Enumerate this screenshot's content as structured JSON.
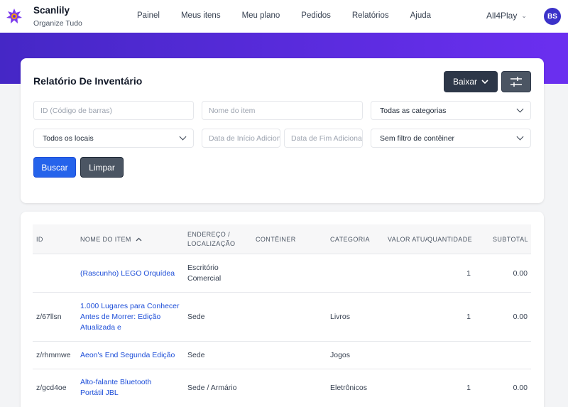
{
  "nav": {
    "brand": "Scanlily",
    "tagline": "Organize Tudo",
    "links": [
      "Painel",
      "Meus itens",
      "Meu plano",
      "Pedidos",
      "Relatórios",
      "Ajuda"
    ],
    "account": "All4Play",
    "avatar_initials": "BS"
  },
  "report": {
    "title": "Relatório De Inventário",
    "download_label": "Baixar",
    "filters": {
      "id_placeholder": "ID (Código de barras)",
      "name_placeholder": "Nome do item",
      "category_selected": "Todas as categorias",
      "location_selected": "Todos os locais",
      "start_date_placeholder": "Data de Início Adicionado",
      "end_date_placeholder": "Data de Fim Adicionado",
      "container_selected": "Sem filtro de contêiner"
    },
    "search_label": "Buscar",
    "clear_label": "Limpar"
  },
  "table": {
    "headers": {
      "id": "ID",
      "name": "NOME DO ITEM",
      "location_1": "ENDEREÇO /",
      "location_2": "LOCALIZAÇÃO",
      "container": "CONTÊINER",
      "category": "CATEGORIA",
      "value": "VALOR ATUAL",
      "quantity": "QUANTIDADE",
      "subtotal": "SUBTOTAL"
    },
    "rows": [
      {
        "id": "",
        "name_1": "(Rascunho) LEGO Orquídea",
        "name_2": "",
        "name_3": "",
        "loc_1": "Escritório",
        "loc_2": "Comercial",
        "container": "",
        "category": "",
        "value": "",
        "quantity": "1",
        "subtotal": "0.00"
      },
      {
        "id": "z/67llsn",
        "name_1": "1.000 Lugares para Conhecer",
        "name_2": "Antes de Morrer: Edição",
        "name_3": "Atualizada e",
        "loc_1": "Sede",
        "loc_2": "",
        "container": "",
        "category": "Livros",
        "value": "",
        "quantity": "1",
        "subtotal": "0.00"
      },
      {
        "id": "z/rhmmwe",
        "name_1": "Aeon's End Segunda Edição",
        "name_2": "",
        "name_3": "",
        "loc_1": "Sede",
        "loc_2": "",
        "container": "",
        "category": "Jogos",
        "value": "",
        "quantity": "",
        "subtotal": ""
      },
      {
        "id": "z/gcd4oe",
        "name_1": "Alto-falante Bluetooth",
        "name_2": "Portátil JBL",
        "name_3": "",
        "loc_1": "Sede / Armário",
        "loc_2": "",
        "container": "",
        "category": "Eletrônicos",
        "value": "",
        "quantity": "1",
        "subtotal": "0.00"
      }
    ]
  },
  "colors": {
    "accent": "#2563eb",
    "band_start": "#4527c6",
    "band_end": "#6b2ff0",
    "dark_button": "#2d3748",
    "avatar": "#3b32c9"
  }
}
